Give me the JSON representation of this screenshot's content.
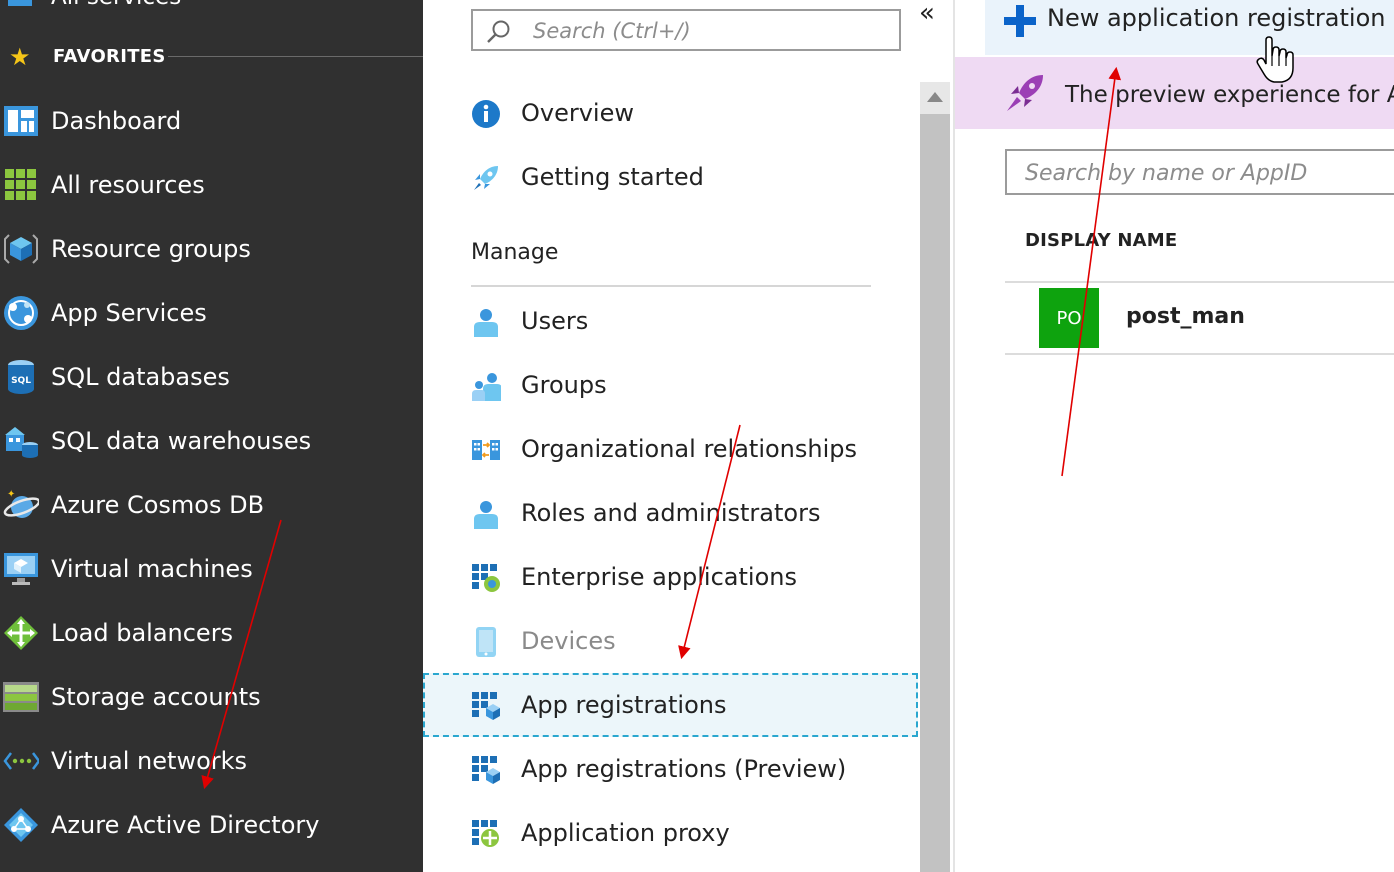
{
  "left_nav": {
    "top_item": "All services",
    "favorites_label": "FAVORITES",
    "items": [
      {
        "label": "Dashboard",
        "icon": "dashboard-icon"
      },
      {
        "label": "All resources",
        "icon": "grid-icon"
      },
      {
        "label": "Resource groups",
        "icon": "cube-icon"
      },
      {
        "label": "App Services",
        "icon": "globe-icon"
      },
      {
        "label": "SQL databases",
        "icon": "sql-icon"
      },
      {
        "label": "SQL data warehouses",
        "icon": "warehouse-icon"
      },
      {
        "label": "Azure Cosmos DB",
        "icon": "planet-icon"
      },
      {
        "label": "Virtual machines",
        "icon": "monitor-icon"
      },
      {
        "label": "Load balancers",
        "icon": "diamond-arrows-icon"
      },
      {
        "label": "Storage accounts",
        "icon": "storage-icon"
      },
      {
        "label": "Virtual networks",
        "icon": "network-icon"
      },
      {
        "label": "Azure Active Directory",
        "icon": "aad-icon"
      }
    ]
  },
  "middle": {
    "search_placeholder": "Search (Ctrl+/)",
    "collapse_glyph": "«",
    "top_items": [
      {
        "label": "Overview",
        "icon": "info-icon"
      },
      {
        "label": "Getting started",
        "icon": "rocket-icon"
      }
    ],
    "manage_heading": "Manage",
    "manage_items": [
      {
        "label": "Users",
        "icon": "user-icon"
      },
      {
        "label": "Groups",
        "icon": "group-icon"
      },
      {
        "label": "Organizational relationships",
        "icon": "org-icon"
      },
      {
        "label": "Roles and administrators",
        "icon": "admin-icon"
      },
      {
        "label": "Enterprise applications",
        "icon": "enterprise-app-icon"
      },
      {
        "label": "Devices",
        "icon": "device-icon"
      },
      {
        "label": "App registrations",
        "icon": "app-reg-icon"
      },
      {
        "label": "App registrations (Preview)",
        "icon": "app-reg-preview-icon"
      },
      {
        "label": "Application proxy",
        "icon": "app-proxy-icon"
      }
    ]
  },
  "right": {
    "new_registration_label": "New application registration",
    "banner_text": "The preview experience for App",
    "search_placeholder": "Search by name or AppID",
    "column_header": "DISPLAY NAME",
    "apps": [
      {
        "initials": "PO",
        "name": "post_man",
        "tile_color": "#0ea30e"
      }
    ]
  },
  "colors": {
    "nav_bg": "#303030",
    "accent_blue": "#0078d4",
    "selected_outline": "#2aa7cf",
    "banner_bg": "#efdaf3",
    "annotation_red": "#e00000"
  }
}
